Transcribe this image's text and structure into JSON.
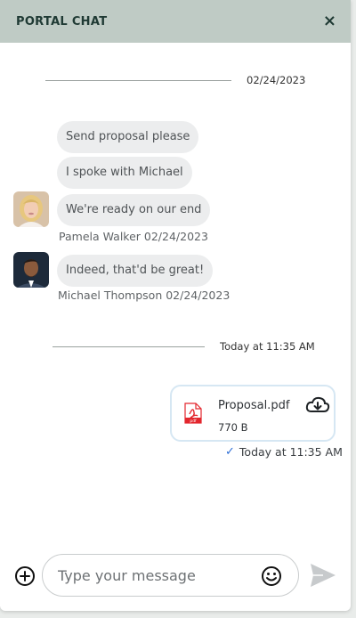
{
  "header": {
    "title": "PORTAL CHAT",
    "close_label": "×"
  },
  "dividers": {
    "first_date": "02/24/2023",
    "second_date": "Today at 11:35 AM"
  },
  "messages": {
    "pamela": {
      "bubbles": [
        "Send proposal please",
        "I spoke with Michael",
        "We're ready on our end"
      ],
      "meta": "Pamela Walker 02/24/2023"
    },
    "michael": {
      "bubbles": [
        "Indeed, that'd be great!"
      ],
      "meta": "Michael Thompson 02/24/2023"
    }
  },
  "attachment": {
    "file_name": "Proposal.pdf",
    "file_size": "770 B",
    "file_type_label": "pdf"
  },
  "sent_status": {
    "time": "Today at 11:35 AM"
  },
  "composer": {
    "placeholder": "Type your message"
  },
  "icons": [
    "close-icon",
    "pdf-file-icon",
    "cloud-download-icon",
    "check-icon",
    "add-circle-icon",
    "emoji-icon",
    "send-icon"
  ],
  "colors": {
    "header_bg": "#bfcbc5",
    "bubble_bg": "#ecedee",
    "accent_blue": "#2f6fd6",
    "file_border": "#d6e7f3",
    "pdf_red": "#e3262d"
  }
}
